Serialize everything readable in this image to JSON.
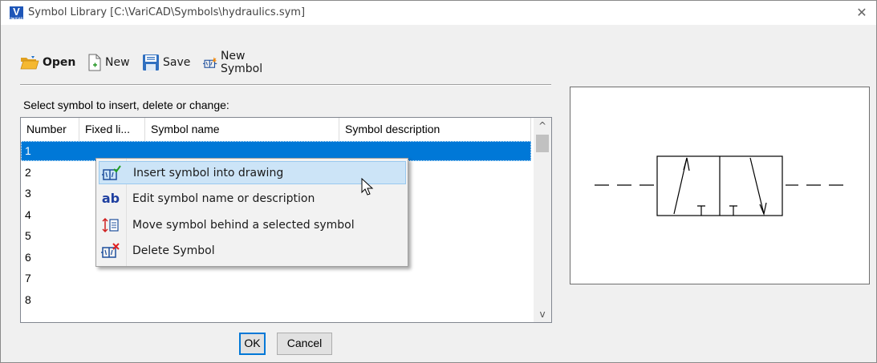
{
  "window": {
    "title": "Symbol Library [C:\\VariCAD\\Symbols\\hydraulics.sym]",
    "logo_letter": "V",
    "logo_sub": "VariCAD",
    "close_glyph": "✕",
    "accent": "#0078d7"
  },
  "toolbar": {
    "open_label": "Open",
    "new_label": "New",
    "save_label": "Save",
    "new_symbol_label": "New Symbol"
  },
  "list": {
    "prompt": "Select symbol to insert, delete or change:",
    "columns": [
      "Number",
      "Fixed li...",
      "Symbol name",
      "Symbol description"
    ],
    "rows": [
      {
        "number": "1",
        "selected": true
      },
      {
        "number": "2"
      },
      {
        "number": "3"
      },
      {
        "number": "4"
      },
      {
        "number": "5"
      },
      {
        "number": "6"
      },
      {
        "number": "7"
      },
      {
        "number": "8"
      }
    ],
    "scroll_up_glyph": "^",
    "scroll_down_glyph": "v"
  },
  "context_menu": {
    "items": [
      {
        "label": "Insert symbol into drawing",
        "icon": "insert-symbol-icon",
        "hover": true
      },
      {
        "label": "Edit symbol name or description",
        "icon": "ab-text-icon"
      },
      {
        "label": "Move symbol behind a selected symbol",
        "icon": "move-order-icon"
      },
      {
        "label": "Delete Symbol",
        "icon": "delete-symbol-icon"
      }
    ],
    "ab_text": "ab"
  },
  "buttons": {
    "ok_label": "OK",
    "cancel_label": "Cancel"
  }
}
